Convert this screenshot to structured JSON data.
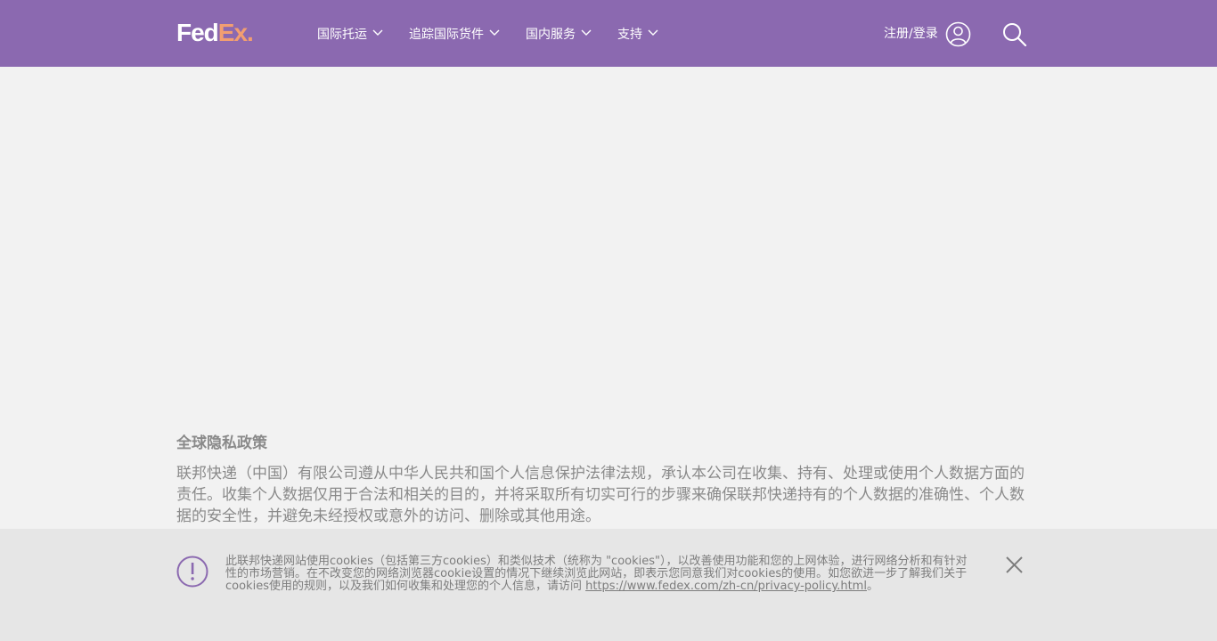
{
  "header": {
    "logo": {
      "part1": "Fed",
      "part2": "Ex",
      "dot": "."
    },
    "nav": [
      {
        "label": "国际托运"
      },
      {
        "label": "追踪国际货件"
      },
      {
        "label": "国内服务"
      },
      {
        "label": "支持"
      }
    ],
    "login_label": "注册/登录"
  },
  "main": {
    "policy_title": "全球隐私政策",
    "policy_body": "联邦快递（中国）有限公司遵从中华人民共和国个人信息保护法律法规，承认本公司在收集、持有、处理或使用个人数据方面的责任。收集个人数据仅用于合法和相关的目的，并将采取所有切实可行的步骤来确保联邦快递持有的个人数据的准确性、个人数据的安全性，并避免未经授权或意外的访问、删除或其他用途。"
  },
  "cookie_banner": {
    "text": "此联邦快递网站使用cookies（包括第三方cookies）和类似技术（统称为 \"cookies\"），以改善使用功能和您的上网体验，进行网络分析和有针对性的市场营销。在不改变您的网络浏览器cookie设置的情况下继续浏览此网站，即表示您同意我们对cookies的使用。如您欲进一步了解我们关于cookies使用的规则，以及我们如何收集和处理您的个人信息，请访问 ",
    "link": "https://www.fedex.com/zh-cn/privacy-policy.html",
    "suffix": "。"
  },
  "colors": {
    "header_bg": "#8b69b0",
    "logo_accent": "#f29e71",
    "page_bg": "#f2f2f2",
    "banner_bg": "#e6e6e6",
    "alert_icon": "#8b69b0"
  },
  "icons": [
    "chevron-down-icon",
    "user-icon",
    "search-icon",
    "alert-icon",
    "close-icon"
  ]
}
